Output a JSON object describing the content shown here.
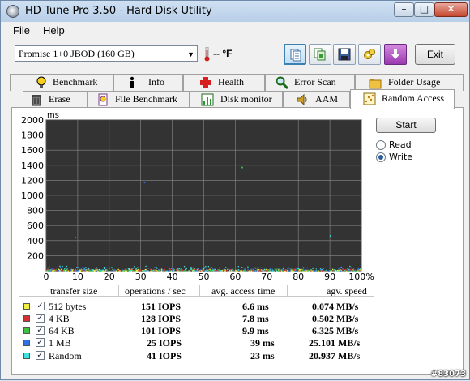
{
  "window": {
    "title": "HD Tune Pro 3.50 - Hard Disk Utility"
  },
  "menu": {
    "file": "File",
    "help": "Help"
  },
  "toolbar": {
    "drive": "Promise 1+0 JBOD (160 GB)",
    "temperature": "-- °F",
    "exit_label": "Exit",
    "buttons": [
      "copy-text-icon",
      "copy-screenshot-icon",
      "save-icon",
      "options-icon",
      "download-icon"
    ]
  },
  "tabs_top": [
    {
      "label": "Benchmark",
      "icon": "lightbulb-icon"
    },
    {
      "label": "Info",
      "icon": "info-icon"
    },
    {
      "label": "Health",
      "icon": "health-cross-icon"
    },
    {
      "label": "Error Scan",
      "icon": "magnifier-icon"
    },
    {
      "label": "Folder Usage",
      "icon": "folder-icon"
    }
  ],
  "tabs_bottom": [
    {
      "label": "Erase",
      "icon": "trash-icon"
    },
    {
      "label": "File Benchmark",
      "icon": "file-benchmark-icon"
    },
    {
      "label": "Disk monitor",
      "icon": "bar-chart-icon"
    },
    {
      "label": "AAM",
      "icon": "speaker-icon"
    },
    {
      "label": "Random Access",
      "icon": "random-access-icon",
      "selected": true
    }
  ],
  "controls": {
    "start_label": "Start",
    "read_label": "Read",
    "write_label": "Write",
    "selected_mode": "Write"
  },
  "chart_data": {
    "type": "scatter",
    "ylabel": "ms",
    "y_ticks": [
      "2000",
      "1800",
      "1600",
      "1400",
      "1200",
      "1000",
      "800",
      "600",
      "400",
      "200"
    ],
    "x_ticks": [
      "0",
      "10",
      "20",
      "30",
      "40",
      "50",
      "60",
      "70",
      "80",
      "90",
      "100%"
    ],
    "ylim": [
      0,
      2000
    ],
    "xlim": [
      0,
      100
    ],
    "grid": true,
    "background": "#333333",
    "series": [
      {
        "color": "#f0f040"
      },
      {
        "color": "#d83030"
      },
      {
        "color": "#40c040"
      },
      {
        "color": "#3070e0"
      },
      {
        "color": "#40e0e0"
      }
    ],
    "outliers": [
      {
        "x": 62,
        "y": 1380,
        "color": "#40c040"
      },
      {
        "x": 31,
        "y": 1180,
        "color": "#3070e0"
      },
      {
        "x": 9,
        "y": 450,
        "color": "#40c040"
      },
      {
        "x": 90,
        "y": 470,
        "color": "#40e0e0"
      }
    ],
    "main_band_ms": 40
  },
  "results": {
    "headers": {
      "transfer_size": "transfer size",
      "ops": "operations / sec",
      "access": "avg. access time",
      "speed": "agv. speed"
    },
    "rows": [
      {
        "label": "512 bytes",
        "color": "#f0f040",
        "checked": "✓",
        "ops": "151 IOPS",
        "access": "6.6 ms",
        "speed": "0.074 MB/s"
      },
      {
        "label": "4 KB",
        "color": "#d83030",
        "checked": "✓",
        "ops": "128 IOPS",
        "access": "7.8 ms",
        "speed": "0.502 MB/s"
      },
      {
        "label": "64 KB",
        "color": "#40c040",
        "checked": "✓",
        "ops": "101 IOPS",
        "access": "9.9 ms",
        "speed": "6.325 MB/s"
      },
      {
        "label": "1 MB",
        "color": "#3070e0",
        "checked": "✓",
        "ops": "25 IOPS",
        "access": "39 ms",
        "speed": "25.101 MB/s"
      },
      {
        "label": "Random",
        "color": "#40e0e0",
        "checked": "✓",
        "ops": "41 IOPS",
        "access": "23 ms",
        "speed": "20.937 MB/s"
      }
    ]
  },
  "watermark": "#83073"
}
